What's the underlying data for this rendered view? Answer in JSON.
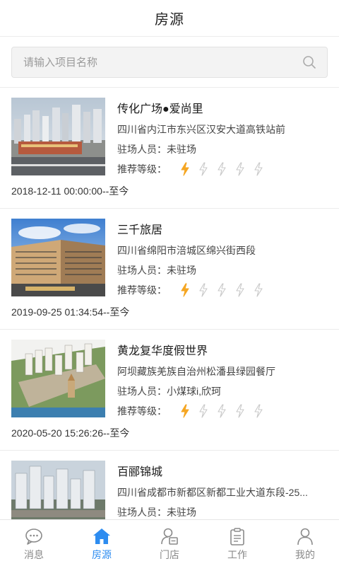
{
  "header": {
    "title": "房源"
  },
  "search": {
    "placeholder": "请输入项目名称",
    "value": ""
  },
  "labels": {
    "staff": "驻场人员：",
    "rating": "推荐等级："
  },
  "colors": {
    "accent": "#2d8cf0",
    "rating_on": "#f5a623",
    "rating_off": "#c8c8c8"
  },
  "projects": [
    {
      "name": "传化广场●爱尚里",
      "address": "四川省内江市东兴区汉安大道高铁站前",
      "staff": "未驻场",
      "rating": 1,
      "rating_max": 5,
      "date": "2018-12-11 00:00:00--至今"
    },
    {
      "name": "三千旅居",
      "address": "四川省绵阳市涪城区绵兴街西段",
      "staff": "未驻场",
      "rating": 1,
      "rating_max": 5,
      "date": "2019-09-25 01:34:54--至今"
    },
    {
      "name": "黄龙复华度假世界",
      "address": "阿坝藏族羌族自治州松潘县绿园餐厅",
      "staff": "小煤球i,欣珂",
      "rating": 1,
      "rating_max": 5,
      "date": "2020-05-20 15:26:26--至今"
    },
    {
      "name": "百郦锦城",
      "address": "四川省成都市新都区新都工业大道东段-25...",
      "staff": "未驻场",
      "rating": 1,
      "rating_max": 5,
      "date": ""
    }
  ],
  "tabs": [
    {
      "label": "消息",
      "icon": "message-icon",
      "active": false
    },
    {
      "label": "房源",
      "icon": "home-icon",
      "active": true
    },
    {
      "label": "门店",
      "icon": "store-icon",
      "active": false
    },
    {
      "label": "工作",
      "icon": "clipboard-icon",
      "active": false
    },
    {
      "label": "我的",
      "icon": "user-icon",
      "active": false
    }
  ]
}
